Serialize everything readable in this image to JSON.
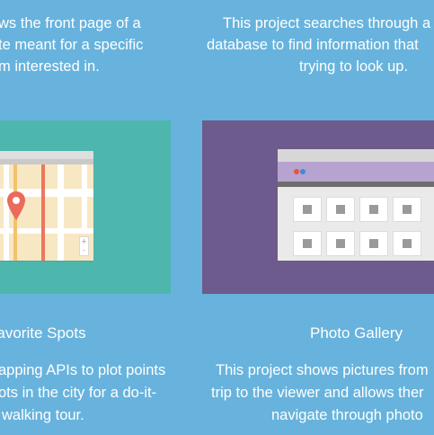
{
  "projects": [
    {
      "description_lines": [
        "ws the front page of a",
        "te meant for a specific",
        "m interested in."
      ]
    },
    {
      "description_lines": [
        "This project searches through a",
        "database to find information that",
        "trying to look up."
      ]
    },
    {
      "title": "Favorite Spots",
      "description_lines": [
        "apping APIs to plot points",
        "ots in the city for a do-it-",
        "walking tour."
      ],
      "map_zoom_in": "+",
      "map_zoom_out": "-"
    },
    {
      "title": "Photo Gallery",
      "description_lines": [
        "This project shows pictures from",
        "trip to the viewer and allows ther",
        "navigate through photo"
      ]
    }
  ],
  "colors": {
    "background": "#67b3dd",
    "map_tile": "#4db6ad",
    "gallery_tile": "#6c5b8c",
    "map_pin": "#ea6b5c"
  },
  "icons": [
    "map-pin-icon",
    "zoom-in-icon",
    "zoom-out-icon",
    "image-thumbnail-icon"
  ]
}
